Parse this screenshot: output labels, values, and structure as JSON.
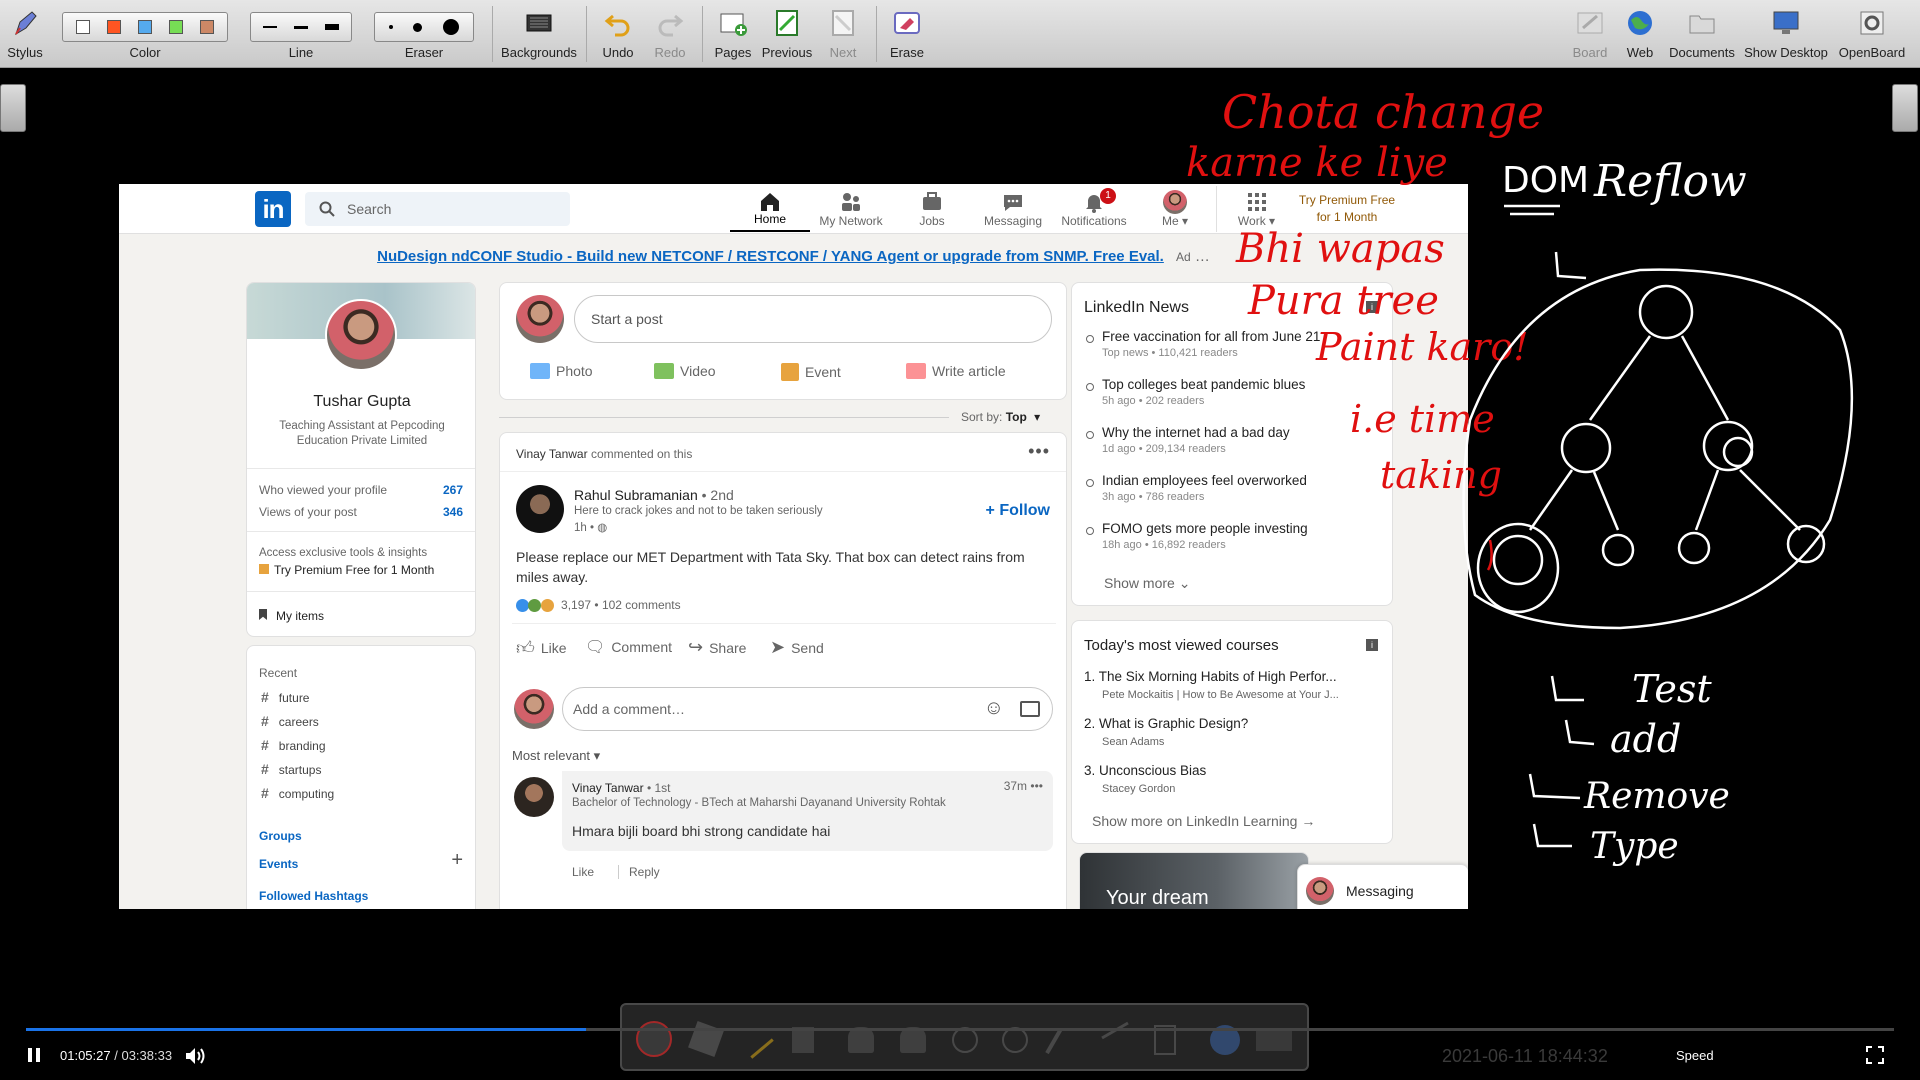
{
  "toolbar": {
    "stylus": "Stylus",
    "color": "Color",
    "color_swatches": [
      "#ffffff",
      "#ff5522",
      "#55aaee",
      "#77dd55",
      "#cc8866"
    ],
    "line": "Line",
    "eraser": "Eraser",
    "backgrounds": "Backgrounds",
    "undo": "Undo",
    "redo": "Redo",
    "pages": "Pages",
    "previous": "Previous",
    "next": "Next",
    "erase": "Erase",
    "board": "Board",
    "web": "Web",
    "documents": "Documents",
    "show_desktop": "Show Desktop",
    "openboard": "OpenBoard"
  },
  "linkedin": {
    "logo": "in",
    "search_placeholder": "Search",
    "nav": {
      "home": "Home",
      "my_network": "My Network",
      "jobs": "Jobs",
      "messaging": "Messaging",
      "notifications": "Notifications",
      "notifications_count": "1",
      "me": "Me",
      "work": "Work",
      "premium": "Try Premium Free for 1 Month"
    },
    "ad": {
      "link": "NuDesign ndCONF Studio - Build new NETCONF / RESTCONF / YANG Agent or upgrade from SNMP. Free Eval.",
      "label": "Ad"
    },
    "profile": {
      "name": "Tushar Gupta",
      "headline": "Teaching Assistant at Pepcoding Education Private Limited",
      "viewed_label": "Who viewed your profile",
      "viewed_count": "267",
      "post_views_label": "Views of your post",
      "post_views_count": "346",
      "premium_note": "Access exclusive tools & insights",
      "premium_link": "Try Premium Free for 1 Month",
      "my_items": "My items"
    },
    "recent": {
      "title": "Recent",
      "tags": [
        "future",
        "careers",
        "branding",
        "startups",
        "computing"
      ],
      "groups": "Groups",
      "events": "Events",
      "followed": "Followed Hashtags"
    },
    "share": {
      "placeholder": "Start a post",
      "photo": "Photo",
      "video": "Video",
      "event": "Event",
      "article": "Write article",
      "sort_label": "Sort by:",
      "sort_value": "Top"
    },
    "post": {
      "context_name": "Vinay Tanwar",
      "context_rest": "commented on this",
      "author": "Rahul Subramanian",
      "degree": "• 2nd",
      "tagline": "Here to crack jokes and not to be taken seriously",
      "time": "1h •",
      "follow": "Follow",
      "text": "Please replace our MET Department with Tata Sky. That box can detect rains from miles away.",
      "reactions": "3,197",
      "comments": "102 comments",
      "like": "Like",
      "comment": "Comment",
      "share": "Share",
      "send": "Send",
      "add_comment": "Add a comment…",
      "most_relevant": "Most relevant",
      "c_author": "Vinay Tanwar",
      "c_degree": "• 1st",
      "c_time": "37m",
      "c_headline": "Bachelor of Technology - BTech at Maharshi Dayanand University Rohtak",
      "c_text": "Hmara bijli board bhi strong candidate hai",
      "c_like": "Like",
      "c_reply": "Reply"
    },
    "news": {
      "title": "LinkedIn News",
      "items": [
        {
          "t": "Free vaccination for all from June 21",
          "s": "Top news • 110,421 readers"
        },
        {
          "t": "Top colleges beat pandemic blues",
          "s": "5h ago • 202 readers"
        },
        {
          "t": "Why the internet had a bad day",
          "s": "1d ago • 209,134 readers"
        },
        {
          "t": "Indian employees feel overworked",
          "s": "3h ago • 786 readers"
        },
        {
          "t": "FOMO gets more people investing",
          "s": "18h ago • 16,892 readers"
        }
      ],
      "show_more": "Show more"
    },
    "courses": {
      "title": "Today's most viewed courses",
      "items": [
        {
          "t": "1. The Six Morning Habits of High Perfor...",
          "s": "Pete Mockaitis | How to Be Awesome at Your J..."
        },
        {
          "t": "2. What is Graphic Design?",
          "s": "Sean Adams"
        },
        {
          "t": "3. Unconscious Bias",
          "s": "Stacey Gordon"
        }
      ],
      "more": "Show more on LinkedIn Learning"
    },
    "promo": "Your dream",
    "messaging": "Messaging"
  },
  "annotations": {
    "red": [
      "Chota change",
      "karne ke liye",
      "Bhi wapas",
      "Pura tree",
      "Paint karo!",
      "i.e time",
      "taking"
    ],
    "white": [
      "DOM",
      "Reflow",
      "Test",
      "add",
      "Remove",
      "Type"
    ]
  },
  "player": {
    "current": "01:05:27",
    "total": "/ 03:38:33",
    "progress": 0.3,
    "speed": "Speed",
    "date": "2021-06-11",
    "time": "18:44:32"
  }
}
